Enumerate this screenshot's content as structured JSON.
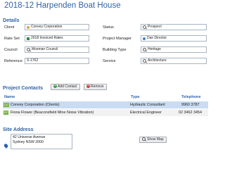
{
  "title": "2018-12 Harpenden Boat House",
  "details": {
    "heading": "Details",
    "left": [
      {
        "label": "Client",
        "value": "Convey Corporation"
      },
      {
        "label": "Rate Set",
        "value": "2018 Invoiced Rates"
      },
      {
        "label": "Council",
        "value": "Mosman Council"
      },
      {
        "label": "Reference",
        "value": "X-1762"
      }
    ],
    "right": [
      {
        "label": "Status",
        "value": "Prospect"
      },
      {
        "label": "Project Manager",
        "value": "Dan Director"
      },
      {
        "label": "Building Type",
        "value": "Heritage"
      },
      {
        "label": "Service",
        "value": "Architecture"
      }
    ]
  },
  "contacts": {
    "heading": "Project Contacts",
    "add_label": "Add Contact",
    "remove_label": "Remove",
    "columns": {
      "name": "Name",
      "type": "Type",
      "phone": "Telephone"
    },
    "rows": [
      {
        "tag": "CC",
        "name": "Convey Corporation (Clients)",
        "type": "Hydraulic Consultant",
        "phone": "9960 3787"
      },
      {
        "tag": "FF",
        "name": "Fiona Flower (Beaconsfield Mine Noise Vibration)",
        "type": "Electrical Engineer",
        "phone": "02 3462 3454"
      }
    ]
  },
  "site": {
    "heading": "Site Address",
    "line1": "42 Universe Avenue",
    "line2": "Sydney NSW 2000",
    "map_button": "Show Map"
  }
}
